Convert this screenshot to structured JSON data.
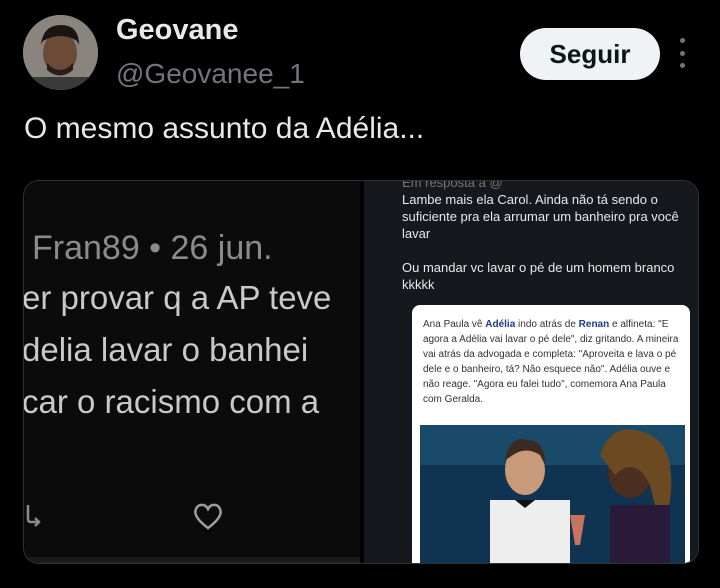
{
  "author": {
    "display_name": "Geovane",
    "handle": "@Geovanee_1"
  },
  "follow_label": "Seguir",
  "tweet_text": "O mesmo assunto da Adélia...",
  "media": {
    "left_image": {
      "lines": [
        "Fran89 • 26 jun.",
        "er provar q a AP teve",
        "delia lavar o banhei",
        "car o racismo com a"
      ]
    },
    "right_image": {
      "reply_header": "Em resposta a @",
      "reply_paragraphs": [
        "Lambe mais ela Carol. Ainda não tá sendo o suficiente pra ela arrumar um banheiro pra você lavar",
        "Ou mandar vc lavar o pé de um homem branco kkkkk"
      ],
      "article": {
        "intro": "Ana Paula vê ",
        "name_1": "Adélia",
        "mid_1": " indo atrás de ",
        "name_2": "Renan",
        "rest": " e alfineta: \"E agora a Adélia vai lavar o pé dele\", diz gritando. A mineira vai atrás da advogada e completa: \"Aproveita e lava o pé dele e o banheiro, tá? Não esquece não\". Adélia ouve e não reage. \"Agora eu falei tudo\", comemora Ana Paula com Geralda."
      }
    }
  },
  "icons": {
    "more": "more-options-icon",
    "retweet": "retweet-icon",
    "heart": "heart-icon"
  }
}
